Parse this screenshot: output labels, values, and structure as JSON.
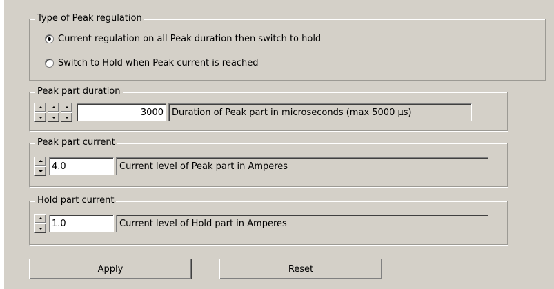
{
  "peak_regulation": {
    "legend": "Type of Peak regulation",
    "options": [
      {
        "label": "Current regulation on all Peak duration then switch to hold",
        "checked": true
      },
      {
        "label": "Switch to Hold when Peak current is reached",
        "checked": false
      }
    ]
  },
  "peak_duration": {
    "legend": "Peak part duration",
    "value": "3000",
    "description": "Duration of Peak part in microseconds  (max 5000 µs)"
  },
  "peak_current": {
    "legend": "Peak part current",
    "value": "4.0",
    "description": "Current level of Peak part in Amperes"
  },
  "hold_current": {
    "legend": "Hold part current",
    "value": "1.0",
    "description": "Current level of Hold part in Amperes"
  },
  "buttons": {
    "apply": "Apply",
    "reset": "Reset"
  },
  "colors": {
    "background": "#d4d0c8",
    "field": "#ffffff"
  }
}
